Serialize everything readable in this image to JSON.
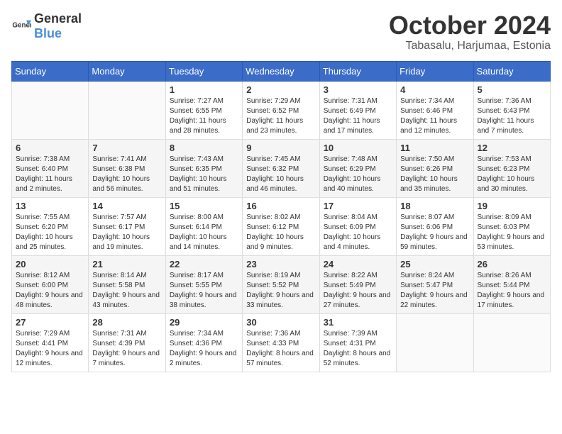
{
  "logo": {
    "text_general": "General",
    "text_blue": "Blue"
  },
  "header": {
    "month": "October 2024",
    "location": "Tabasalu, Harjumaa, Estonia"
  },
  "weekdays": [
    "Sunday",
    "Monday",
    "Tuesday",
    "Wednesday",
    "Thursday",
    "Friday",
    "Saturday"
  ],
  "weeks": [
    [
      {
        "day": "",
        "info": ""
      },
      {
        "day": "",
        "info": ""
      },
      {
        "day": "1",
        "info": "Sunrise: 7:27 AM\nSunset: 6:55 PM\nDaylight: 11 hours and 28 minutes."
      },
      {
        "day": "2",
        "info": "Sunrise: 7:29 AM\nSunset: 6:52 PM\nDaylight: 11 hours and 23 minutes."
      },
      {
        "day": "3",
        "info": "Sunrise: 7:31 AM\nSunset: 6:49 PM\nDaylight: 11 hours and 17 minutes."
      },
      {
        "day": "4",
        "info": "Sunrise: 7:34 AM\nSunset: 6:46 PM\nDaylight: 11 hours and 12 minutes."
      },
      {
        "day": "5",
        "info": "Sunrise: 7:36 AM\nSunset: 6:43 PM\nDaylight: 11 hours and 7 minutes."
      }
    ],
    [
      {
        "day": "6",
        "info": "Sunrise: 7:38 AM\nSunset: 6:40 PM\nDaylight: 11 hours and 2 minutes."
      },
      {
        "day": "7",
        "info": "Sunrise: 7:41 AM\nSunset: 6:38 PM\nDaylight: 10 hours and 56 minutes."
      },
      {
        "day": "8",
        "info": "Sunrise: 7:43 AM\nSunset: 6:35 PM\nDaylight: 10 hours and 51 minutes."
      },
      {
        "day": "9",
        "info": "Sunrise: 7:45 AM\nSunset: 6:32 PM\nDaylight: 10 hours and 46 minutes."
      },
      {
        "day": "10",
        "info": "Sunrise: 7:48 AM\nSunset: 6:29 PM\nDaylight: 10 hours and 40 minutes."
      },
      {
        "day": "11",
        "info": "Sunrise: 7:50 AM\nSunset: 6:26 PM\nDaylight: 10 hours and 35 minutes."
      },
      {
        "day": "12",
        "info": "Sunrise: 7:53 AM\nSunset: 6:23 PM\nDaylight: 10 hours and 30 minutes."
      }
    ],
    [
      {
        "day": "13",
        "info": "Sunrise: 7:55 AM\nSunset: 6:20 PM\nDaylight: 10 hours and 25 minutes."
      },
      {
        "day": "14",
        "info": "Sunrise: 7:57 AM\nSunset: 6:17 PM\nDaylight: 10 hours and 19 minutes."
      },
      {
        "day": "15",
        "info": "Sunrise: 8:00 AM\nSunset: 6:14 PM\nDaylight: 10 hours and 14 minutes."
      },
      {
        "day": "16",
        "info": "Sunrise: 8:02 AM\nSunset: 6:12 PM\nDaylight: 10 hours and 9 minutes."
      },
      {
        "day": "17",
        "info": "Sunrise: 8:04 AM\nSunset: 6:09 PM\nDaylight: 10 hours and 4 minutes."
      },
      {
        "day": "18",
        "info": "Sunrise: 8:07 AM\nSunset: 6:06 PM\nDaylight: 9 hours and 59 minutes."
      },
      {
        "day": "19",
        "info": "Sunrise: 8:09 AM\nSunset: 6:03 PM\nDaylight: 9 hours and 53 minutes."
      }
    ],
    [
      {
        "day": "20",
        "info": "Sunrise: 8:12 AM\nSunset: 6:00 PM\nDaylight: 9 hours and 48 minutes."
      },
      {
        "day": "21",
        "info": "Sunrise: 8:14 AM\nSunset: 5:58 PM\nDaylight: 9 hours and 43 minutes."
      },
      {
        "day": "22",
        "info": "Sunrise: 8:17 AM\nSunset: 5:55 PM\nDaylight: 9 hours and 38 minutes."
      },
      {
        "day": "23",
        "info": "Sunrise: 8:19 AM\nSunset: 5:52 PM\nDaylight: 9 hours and 33 minutes."
      },
      {
        "day": "24",
        "info": "Sunrise: 8:22 AM\nSunset: 5:49 PM\nDaylight: 9 hours and 27 minutes."
      },
      {
        "day": "25",
        "info": "Sunrise: 8:24 AM\nSunset: 5:47 PM\nDaylight: 9 hours and 22 minutes."
      },
      {
        "day": "26",
        "info": "Sunrise: 8:26 AM\nSunset: 5:44 PM\nDaylight: 9 hours and 17 minutes."
      }
    ],
    [
      {
        "day": "27",
        "info": "Sunrise: 7:29 AM\nSunset: 4:41 PM\nDaylight: 9 hours and 12 minutes."
      },
      {
        "day": "28",
        "info": "Sunrise: 7:31 AM\nSunset: 4:39 PM\nDaylight: 9 hours and 7 minutes."
      },
      {
        "day": "29",
        "info": "Sunrise: 7:34 AM\nSunset: 4:36 PM\nDaylight: 9 hours and 2 minutes."
      },
      {
        "day": "30",
        "info": "Sunrise: 7:36 AM\nSunset: 4:33 PM\nDaylight: 8 hours and 57 minutes."
      },
      {
        "day": "31",
        "info": "Sunrise: 7:39 AM\nSunset: 4:31 PM\nDaylight: 8 hours and 52 minutes."
      },
      {
        "day": "",
        "info": ""
      },
      {
        "day": "",
        "info": ""
      }
    ]
  ]
}
